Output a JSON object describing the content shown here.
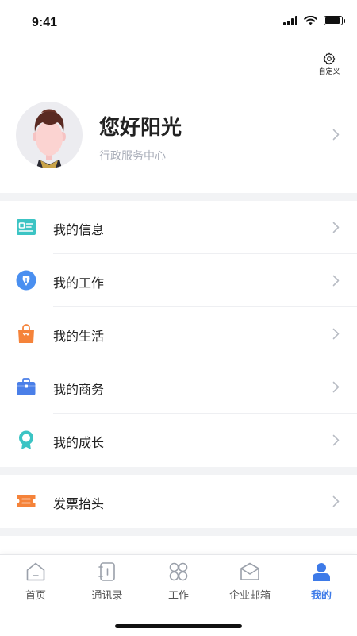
{
  "status": {
    "time": "9:41"
  },
  "header": {
    "customize_label": "自定义"
  },
  "profile": {
    "name": "您好阳光",
    "department": "行政服务中心"
  },
  "menu": {
    "group1": [
      {
        "label": "我的信息",
        "icon": "id-card-icon",
        "color": "#3cc4c4"
      },
      {
        "label": "我的工作",
        "icon": "pen-nib-icon",
        "color": "#4a8ff0"
      },
      {
        "label": "我的生活",
        "icon": "shopping-bag-icon",
        "color": "#f5833a"
      },
      {
        "label": "我的商务",
        "icon": "briefcase-icon",
        "color": "#4a7fe8"
      },
      {
        "label": "我的成长",
        "icon": "award-badge-icon",
        "color": "#3cc4c4"
      }
    ],
    "group2": [
      {
        "label": "发票抬头",
        "icon": "ticket-icon",
        "color": "#f5833a"
      }
    ]
  },
  "tabbar": {
    "tabs": [
      {
        "label": "首页",
        "icon": "home-icon",
        "active": false
      },
      {
        "label": "通讯录",
        "icon": "contacts-icon",
        "active": false
      },
      {
        "label": "工作",
        "icon": "apps-grid-icon",
        "active": false
      },
      {
        "label": "企业邮箱",
        "icon": "mail-icon",
        "active": false
      },
      {
        "label": "我的",
        "icon": "person-icon",
        "active": true
      }
    ],
    "active_color": "#3d7ae8",
    "inactive_color": "#9aa0aa"
  }
}
